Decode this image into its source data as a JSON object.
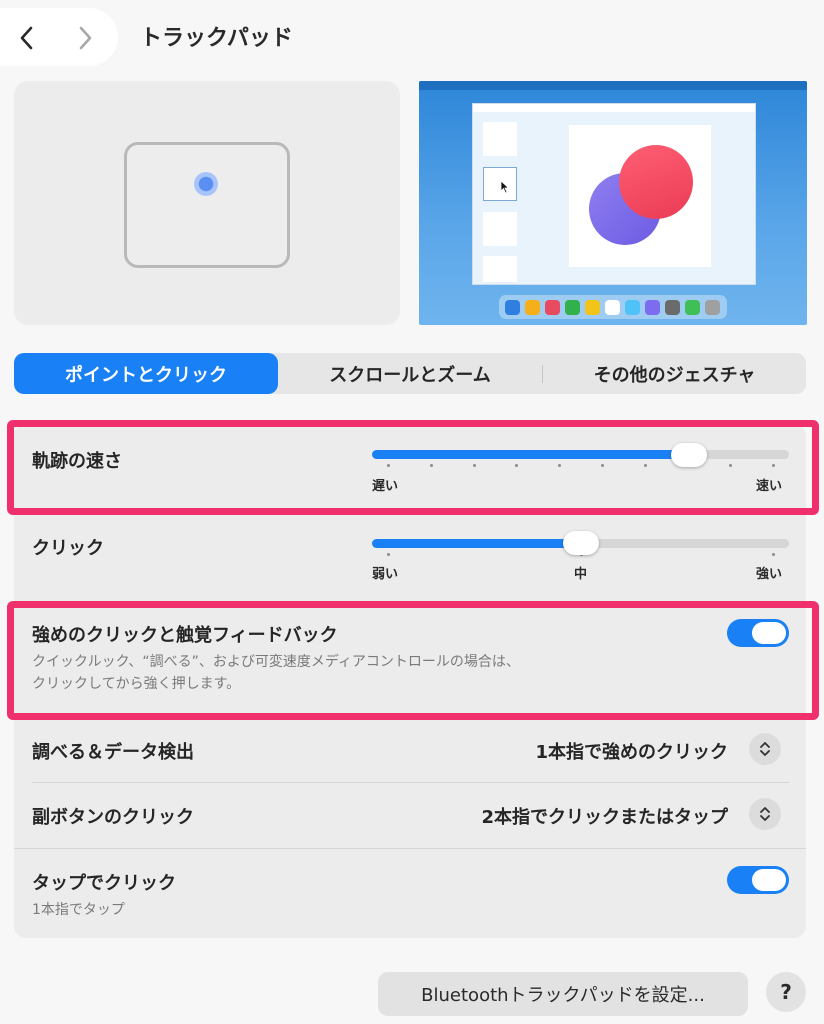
{
  "header": {
    "title": "トラックパッド",
    "back_icon": "chevron-left-icon",
    "forward_icon": "chevron-right-icon"
  },
  "tabs": [
    {
      "label": "ポイントとクリック",
      "active": true
    },
    {
      "label": "スクロールとズーム",
      "active": false
    },
    {
      "label": "その他のジェスチャ",
      "active": false
    }
  ],
  "settings": {
    "tracking_speed": {
      "label": "軌跡の速さ",
      "min_label": "遅い",
      "max_label": "速い",
      "value_fraction": 0.76
    },
    "click": {
      "label": "クリック",
      "labels": [
        "弱い",
        "中",
        "強い"
      ],
      "value_fraction": 0.5
    },
    "force_click": {
      "label": "強めのクリックと触覚フィードバック",
      "description_line1": "クイックルック、“調べる”、および可変速度メディアコントロールの場合は、",
      "description_line2": "クリックしてから強く押します。",
      "enabled": true
    },
    "lookup": {
      "label": "調べる＆データ検出",
      "value": "1本指で強めのクリック"
    },
    "secondary_click": {
      "label": "副ボタンのクリック",
      "value": "2本指でクリックまたはタップ"
    },
    "tap_to_click": {
      "label": "タップでクリック",
      "description": "1本指でタップ",
      "enabled": true
    }
  },
  "footer": {
    "bluetooth_button": "Bluetoothトラックパッドを設定...",
    "help_button": "?"
  },
  "colors": {
    "accent": "#1a80f5",
    "highlight": "#f0306d"
  },
  "dock_colors": [
    "#2f7fe0",
    "#f5b019",
    "#e84a5f",
    "#31b04c",
    "#f2c318",
    "#ffffff",
    "#4fc3f7",
    "#7d6cf0",
    "#6b6b6b",
    "#3fbf55",
    "#a0a0a0"
  ]
}
